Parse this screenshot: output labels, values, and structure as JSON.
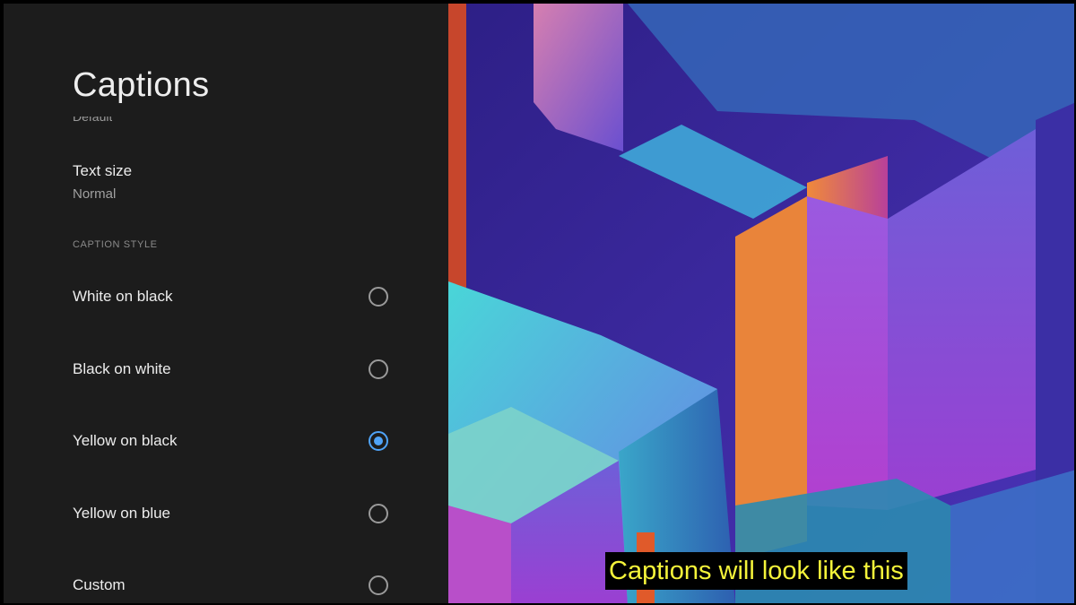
{
  "panel": {
    "title": "Captions",
    "clipped_value": "Default",
    "text_size": {
      "label": "Text size",
      "value": "Normal"
    },
    "section_header": "CAPTION STYLE",
    "options": [
      {
        "label": "White on black",
        "selected": false
      },
      {
        "label": "Black on white",
        "selected": false
      },
      {
        "label": "Yellow on black",
        "selected": true
      },
      {
        "label": "Yellow on blue",
        "selected": false
      },
      {
        "label": "Custom",
        "selected": false
      }
    ]
  },
  "preview": {
    "caption_text": "Captions will look like this",
    "caption_color": "#f4f33a",
    "caption_background": "#000000"
  },
  "colors": {
    "panel_bg": "#1c1c1c",
    "accent": "#4fa3f7"
  }
}
